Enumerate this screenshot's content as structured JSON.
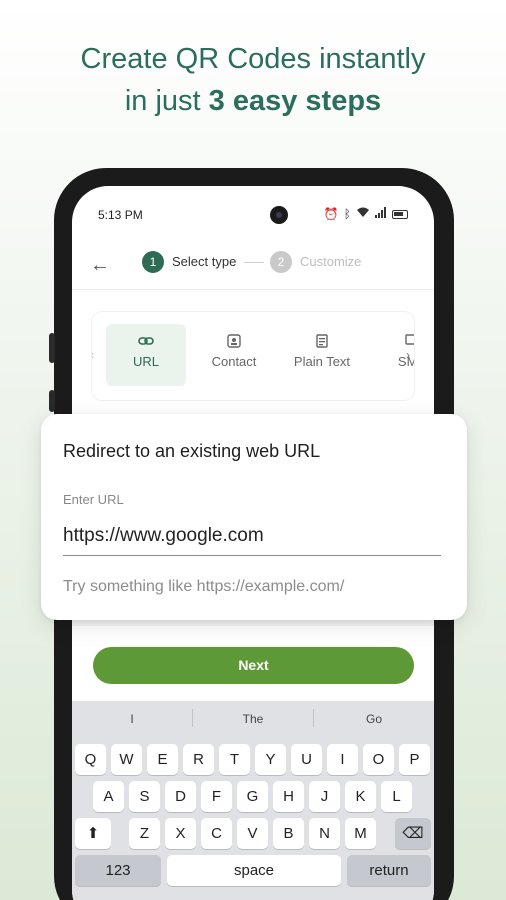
{
  "headline": {
    "line1": "Create QR Codes instantly",
    "line2_prefix": "in just ",
    "line2_bold": "3 easy steps"
  },
  "status_bar": {
    "time": "5:13 PM",
    "icons": [
      "alarm-icon",
      "bluetooth-icon",
      "wifi-icon",
      "signal-icon",
      "battery-icon"
    ]
  },
  "stepper": {
    "steps": [
      {
        "number": "1",
        "label": "Select type",
        "state": "active"
      },
      {
        "number": "2",
        "label": "Customize",
        "state": "inactive"
      }
    ]
  },
  "types": [
    {
      "label": "URL",
      "icon": "link-icon",
      "selected": true
    },
    {
      "label": "Contact",
      "icon": "contact-icon",
      "selected": false
    },
    {
      "label": "Plain Text",
      "icon": "text-icon",
      "selected": false
    },
    {
      "label": "SMS",
      "icon": "sms-icon",
      "selected": false
    }
  ],
  "url_form": {
    "title": "Redirect to an existing web URL",
    "label": "Enter URL",
    "value": "https://www.google.com",
    "hint": "Try something like https://example.com/"
  },
  "next_button": "Next",
  "keyboard": {
    "suggestions": [
      "I",
      "The",
      "Go"
    ],
    "row1": [
      "Q",
      "W",
      "E",
      "R",
      "T",
      "Y",
      "U",
      "I",
      "O",
      "P"
    ],
    "row2": [
      "A",
      "S",
      "D",
      "F",
      "G",
      "H",
      "J",
      "K",
      "L"
    ],
    "row3": [
      "Z",
      "X",
      "C",
      "V",
      "B",
      "N",
      "M"
    ],
    "numbers_key": "123",
    "space_key": "space",
    "return_key": "return"
  },
  "colors": {
    "brand": "#2d6b55",
    "next_button": "#5d9936",
    "headline": "#2b6e5c"
  }
}
